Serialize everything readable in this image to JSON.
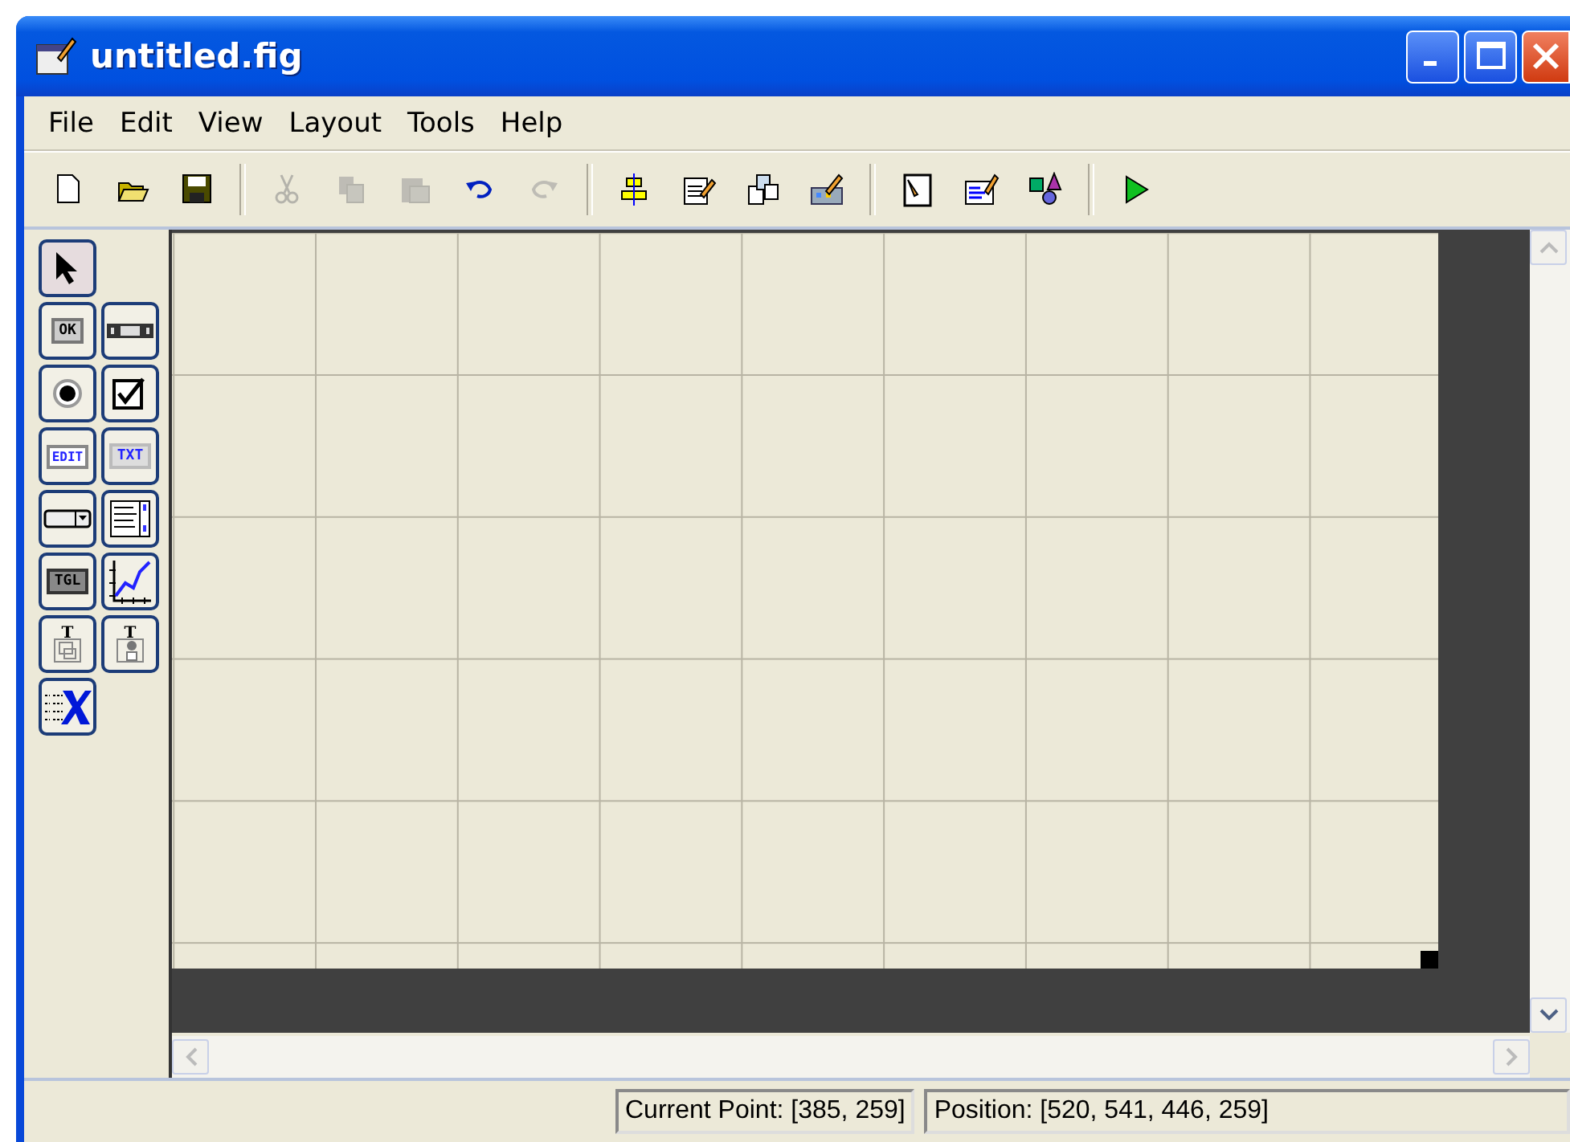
{
  "window": {
    "title": "untitled.fig"
  },
  "menu": [
    "File",
    "Edit",
    "View",
    "Layout",
    "Tools",
    "Help"
  ],
  "toolbar": [
    {
      "kind": "new",
      "disabled": false
    },
    {
      "kind": "open",
      "disabled": false
    },
    {
      "kind": "save",
      "disabled": false
    },
    {
      "kind": "sep"
    },
    {
      "kind": "cut",
      "disabled": true
    },
    {
      "kind": "copy",
      "disabled": true
    },
    {
      "kind": "paste",
      "disabled": true
    },
    {
      "kind": "undo",
      "disabled": false
    },
    {
      "kind": "redo",
      "disabled": true
    },
    {
      "kind": "sep"
    },
    {
      "kind": "align",
      "disabled": false
    },
    {
      "kind": "menueditor",
      "disabled": false
    },
    {
      "kind": "taborder",
      "disabled": false
    },
    {
      "kind": "tooleditor",
      "disabled": false
    },
    {
      "kind": "sep"
    },
    {
      "kind": "editor",
      "disabled": false
    },
    {
      "kind": "inspector",
      "disabled": false
    },
    {
      "kind": "browser",
      "disabled": false
    },
    {
      "kind": "sep"
    },
    {
      "kind": "run",
      "disabled": false
    }
  ],
  "palette": [
    {
      "kind": "select",
      "selected": true
    },
    {
      "kind": "spacer"
    },
    {
      "kind": "push",
      "label": "OK",
      "selected": false
    },
    {
      "kind": "slider",
      "selected": false
    },
    {
      "kind": "radio",
      "selected": false
    },
    {
      "kind": "check",
      "selected": false
    },
    {
      "kind": "edit",
      "label": "EDIT",
      "selected": false
    },
    {
      "kind": "text",
      "label": "TXT",
      "selected": false
    },
    {
      "kind": "popup",
      "selected": false
    },
    {
      "kind": "listbox",
      "selected": false
    },
    {
      "kind": "toggle",
      "label": "TGL",
      "selected": false
    },
    {
      "kind": "axes",
      "selected": false
    },
    {
      "kind": "panel",
      "label": "T",
      "selected": false
    },
    {
      "kind": "group",
      "label": "T",
      "selected": false
    },
    {
      "kind": "activex",
      "selected": false
    }
  ],
  "status_bar": {
    "current_point": "Current Point:  [385, 259]",
    "position": "Position: [520, 541, 446, 259]"
  }
}
